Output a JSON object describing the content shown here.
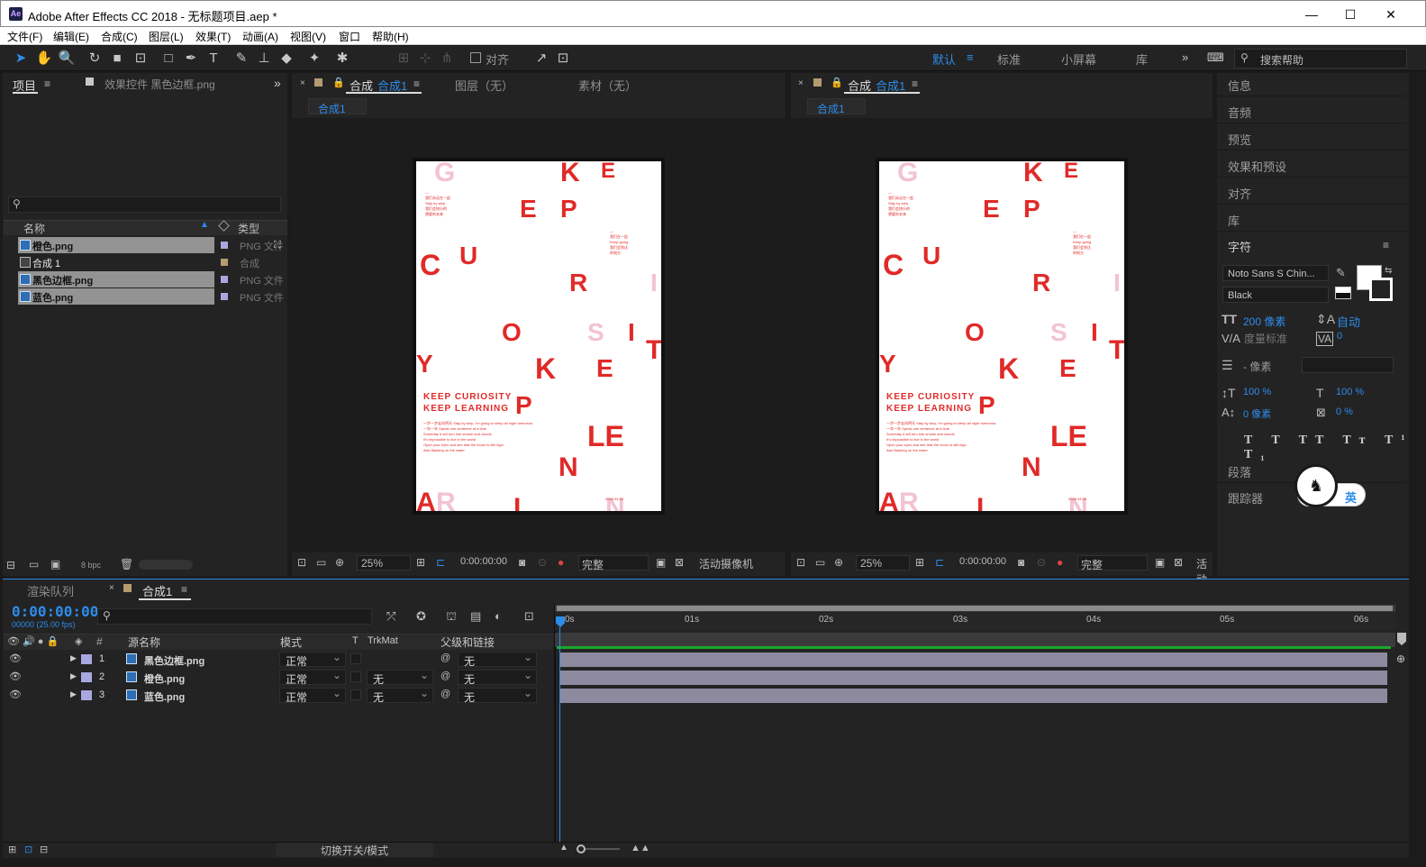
{
  "window": {
    "title": "Adobe After Effects CC 2018 - 无标题项目.aep *",
    "logo": "Ae"
  },
  "menu": [
    "文件(F)",
    "编辑(E)",
    "合成(C)",
    "图层(L)",
    "效果(T)",
    "动画(A)",
    "视图(V)",
    "窗口",
    "帮助(H)"
  ],
  "toolbar": {
    "snap_label": "对齐",
    "workspaces": [
      "默认",
      "标准",
      "小屏幕",
      "库"
    ],
    "search_placeholder": "搜索帮助"
  },
  "project": {
    "tab_project": "项目",
    "tab_effects": "效果控件 黑色边框.png",
    "col_name": "名称",
    "col_type": "类型",
    "items": [
      {
        "name": "橙色.png",
        "type": "PNG 文件",
        "color": "#a9a7e0",
        "selected": true
      },
      {
        "name": "合成 1",
        "type": "合成",
        "color": "#b59b70",
        "selected": false
      },
      {
        "name": "黑色边框.png",
        "type": "PNG 文件",
        "color": "#a9a7e0",
        "selected": true
      },
      {
        "name": "蓝色.png",
        "type": "PNG 文件",
        "color": "#a9a7e0",
        "selected": true
      }
    ],
    "bpc": "8 bpc"
  },
  "viewer1": {
    "tab_comp": "合成",
    "tab_comp_name": "合成1",
    "tab_layer": "图层（无）",
    "tab_footage": "素材（无）",
    "subtab": "合成1",
    "zoom": "25%",
    "timecode": "0:00:00:00",
    "resolution": "完整",
    "camera": "活动摄像机"
  },
  "viewer2": {
    "tab_comp": "合成",
    "tab_comp_name": "合成1",
    "subtab": "合成1",
    "zoom": "25%",
    "timecode": "0:00:00:00",
    "resolution": "完整",
    "camera": "活动"
  },
  "poster": {
    "line1": "KEEP CURIOSITY",
    "line2": "KEEP LEARNING"
  },
  "right_panel": {
    "items": [
      "信息",
      "音频",
      "预览",
      "效果和预设",
      "对齐",
      "库"
    ],
    "character_title": "字符",
    "font": "Noto Sans S Chin...",
    "style": "Black",
    "size": "200 像素",
    "leading": "自动",
    "kerning": "度量标准",
    "tracking": "0",
    "stroke": "- 像素",
    "vscale": "100 %",
    "hscale": "100 %",
    "baseline": "0 像素",
    "tsume": "0 %",
    "bottom": [
      "段落",
      "跟踪器"
    ],
    "ime": "英"
  },
  "timeline": {
    "tab_render": "渲染队列",
    "tab_comp": "合成1",
    "time": "0:00:00:00",
    "fps": "00000 (25.00 fps)",
    "col_hash": "#",
    "col_source": "源名称",
    "col_mode": "模式",
    "col_t": "T",
    "col_trkmat": "TrkMat",
    "col_parent": "父级和链接",
    "layers": [
      {
        "num": "1",
        "name": "黑色边框.png",
        "mode": "正常",
        "trkmat": "",
        "parent": "无"
      },
      {
        "num": "2",
        "name": "橙色.png",
        "mode": "正常",
        "trkmat": "无",
        "parent": "无"
      },
      {
        "num": "3",
        "name": "蓝色.png",
        "mode": "正常",
        "trkmat": "无",
        "parent": "无"
      }
    ],
    "ticks": [
      "0s",
      "01s",
      "02s",
      "03s",
      "04s",
      "05s",
      "06s"
    ],
    "toggle": "切换开关/模式"
  }
}
